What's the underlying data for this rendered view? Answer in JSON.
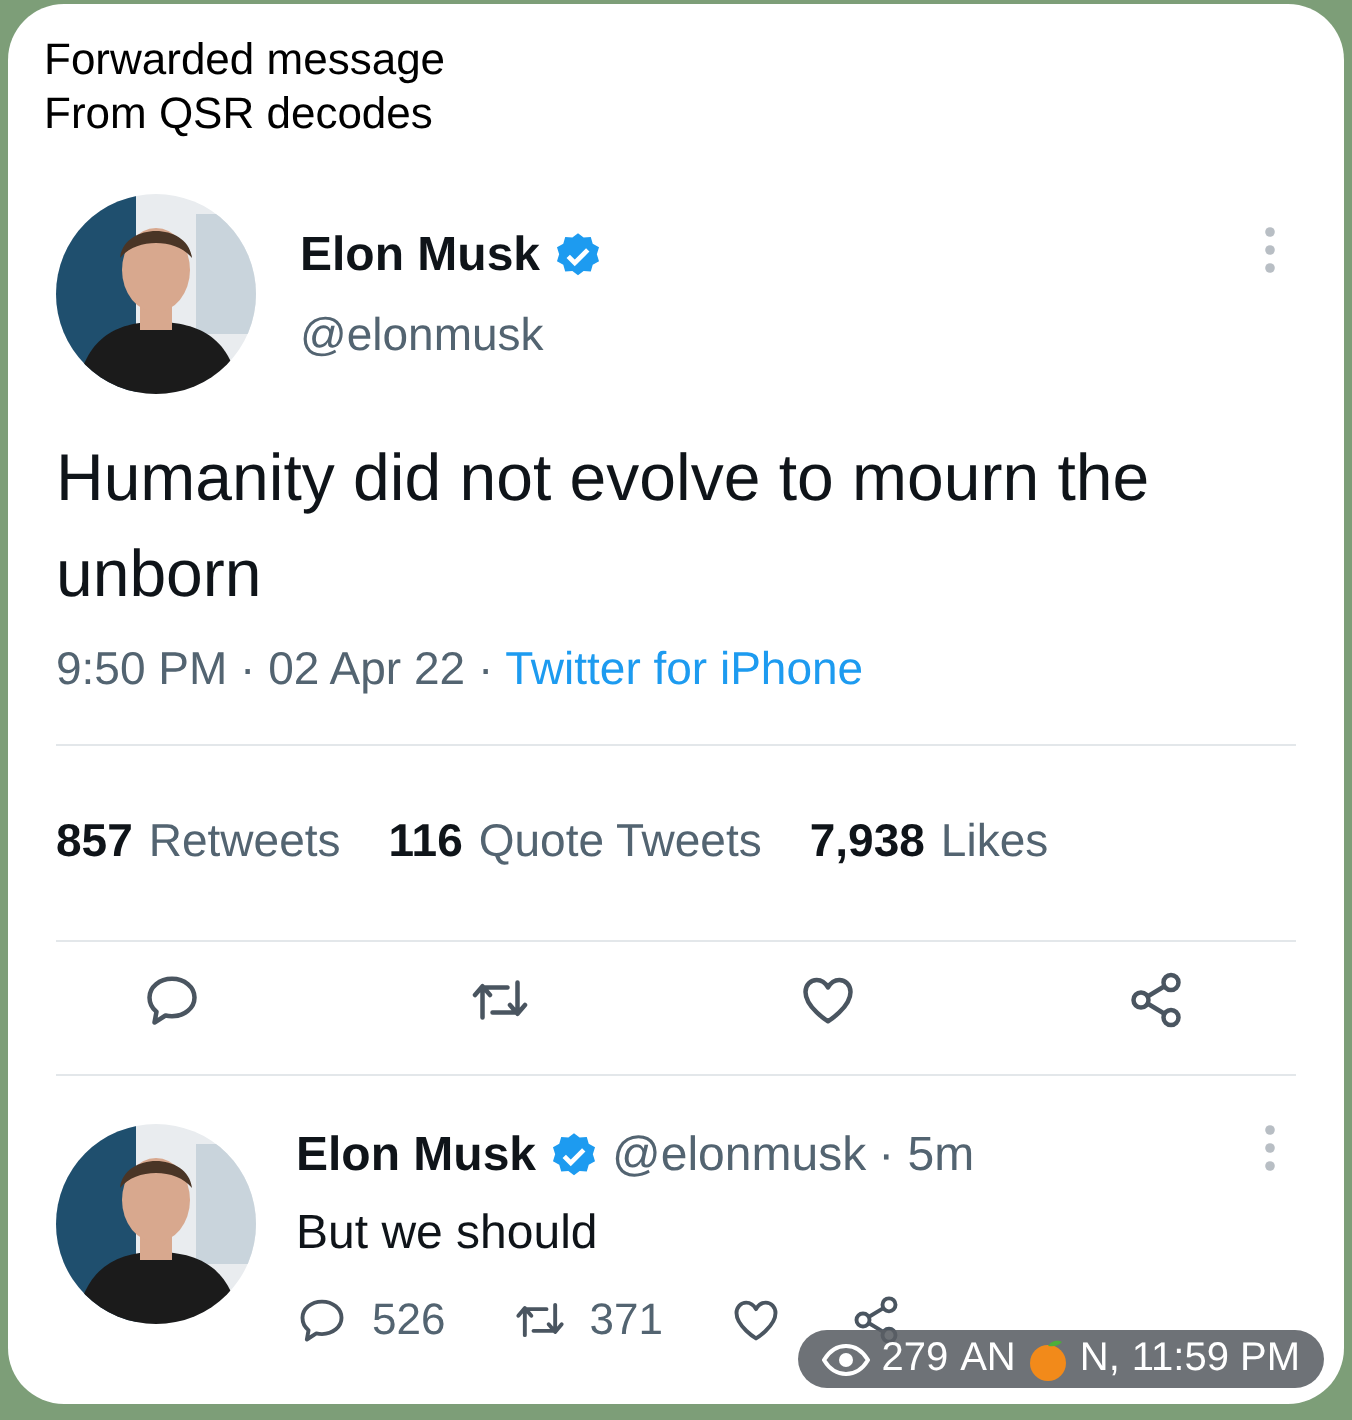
{
  "forward": {
    "title": "Forwarded message",
    "source": "From QSR decodes"
  },
  "tweet": {
    "name": "Elon Musk",
    "verified": true,
    "handle": "@elonmusk",
    "text": "Humanity did not evolve to mourn the unborn",
    "date_line": "9:50 PM · 02 Apr 22 ·",
    "client": "Twitter for iPhone",
    "stats": [
      {
        "count": "857",
        "label": "Retweets"
      },
      {
        "count": "116",
        "label": "Quote Tweets"
      },
      {
        "count": "7,938",
        "label": "Likes"
      }
    ],
    "actions": [
      {
        "kind": "reply"
      },
      {
        "kind": "retweet"
      },
      {
        "kind": "like"
      },
      {
        "kind": "share"
      }
    ]
  },
  "reply": {
    "name": "Elon Musk",
    "verified": true,
    "handle": "@elonmusk",
    "age": "· 5m",
    "text": "But we should",
    "actions": [
      {
        "kind": "reply",
        "count": "526"
      },
      {
        "kind": "retweet",
        "count": "371"
      },
      {
        "kind": "like"
      },
      {
        "kind": "share"
      }
    ]
  },
  "message_meta": {
    "views": "279",
    "author_start": "AN",
    "author_end": "N,",
    "time": "11:59 PM"
  }
}
